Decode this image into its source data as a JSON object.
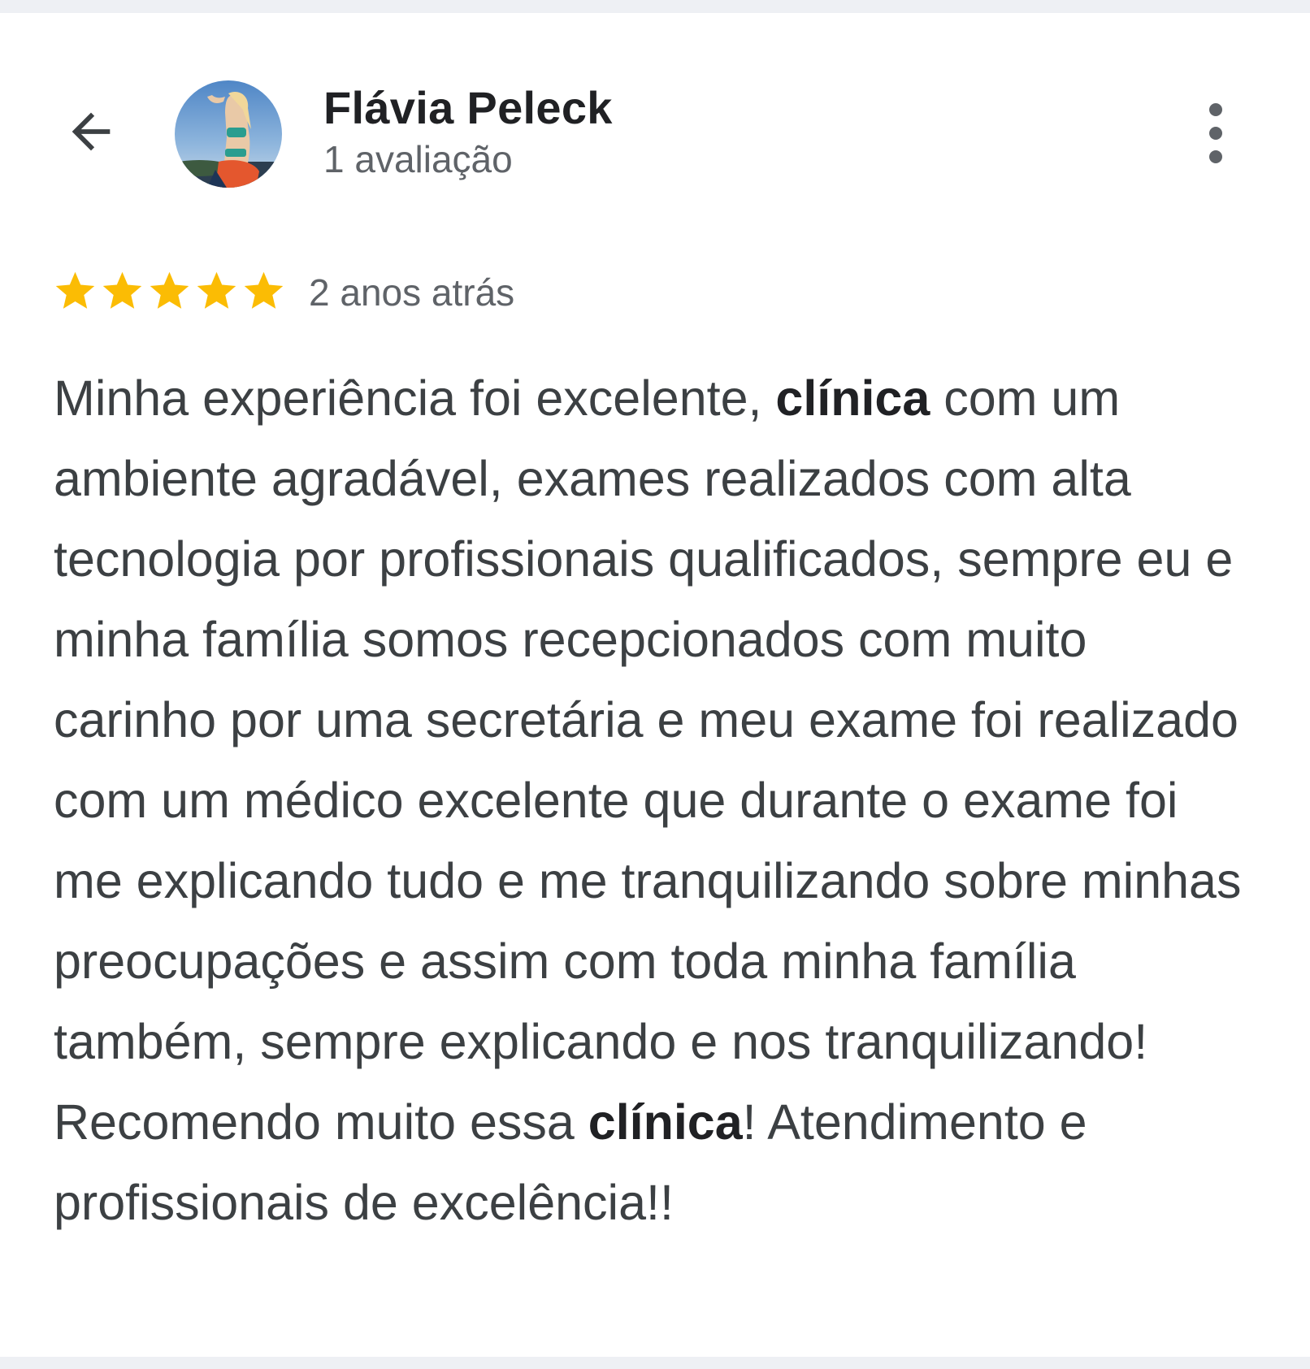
{
  "header": {
    "back_icon": "arrow-back-icon",
    "reviewer_name": "Flávia Peleck",
    "review_count": "1 avaliação",
    "menu_icon": "more-vertical-icon"
  },
  "review": {
    "rating": 5,
    "rating_max": 5,
    "star_color": "#fbbc04",
    "date": "2 anos atrás",
    "text_segments": [
      "Minha experiência foi excelente, ",
      "clínica",
      " com um ambiente agradável, exames realizados com alta tecnologia por profissionais qualificados, sempre eu e minha família somos recepcionados com muito carinho por uma secretária e meu exame foi realizado com um médico excelente que durante o exame foi me explicando tudo e me tranquilizando sobre minhas preocupações e assim com toda minha família também, sempre explicando e nos tranquilizando! Recomendo muito essa ",
      "clínica",
      "! Atendimento e profissionais de excelência!!"
    ]
  }
}
